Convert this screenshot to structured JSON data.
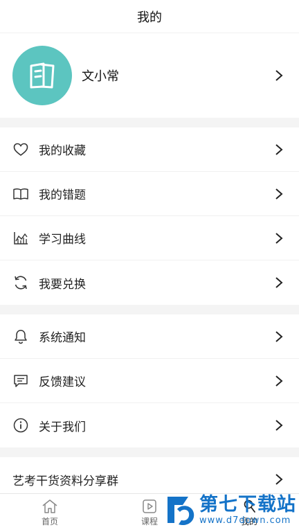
{
  "header": {
    "title": "我的"
  },
  "profile": {
    "name": "文小常"
  },
  "menu_group_1": [
    {
      "label": "我的收藏",
      "icon": "heart-icon"
    },
    {
      "label": "我的错题",
      "icon": "book-icon"
    },
    {
      "label": "学习曲线",
      "icon": "chart-icon"
    },
    {
      "label": "我要兑换",
      "icon": "refresh-icon"
    }
  ],
  "menu_group_2": [
    {
      "label": "系统通知",
      "icon": "bell-icon"
    },
    {
      "label": "反馈建议",
      "icon": "message-icon"
    },
    {
      "label": "关于我们",
      "icon": "info-icon"
    }
  ],
  "menu_group_3": [
    {
      "label": "艺考干货资料分享群"
    }
  ],
  "tabbar": {
    "home": "首页",
    "course": "课程",
    "mine": "我的"
  },
  "watermark": {
    "title": "第七下载站",
    "url": "www.d7down.com"
  },
  "colors": {
    "accent": "#5cc5c0",
    "divider": "#f4f4f4",
    "watermark": "#1473c8"
  }
}
